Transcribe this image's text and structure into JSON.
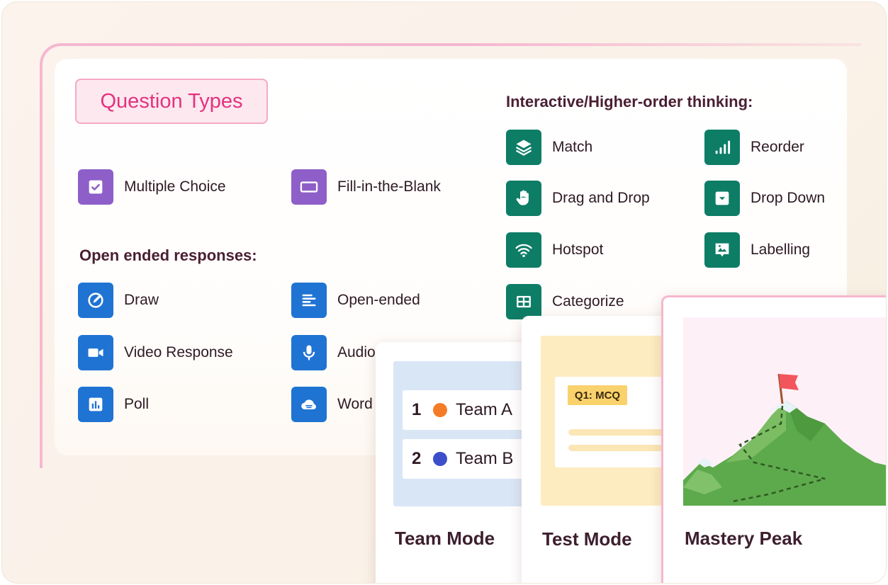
{
  "title": "Question Types",
  "basic_items": [
    {
      "label": "Multiple Choice",
      "icon": "checkbox-icon"
    },
    {
      "label": "Fill-in-the-Blank",
      "icon": "blank-box-icon"
    }
  ],
  "open_ended": {
    "heading": "Open ended responses:",
    "items": [
      {
        "label": "Draw",
        "icon": "pen-icon"
      },
      {
        "label": "Open-ended",
        "icon": "text-lines-icon"
      },
      {
        "label": "Video Response",
        "icon": "video-camera-icon"
      },
      {
        "label": "Audio",
        "icon": "microphone-icon"
      },
      {
        "label": "Poll",
        "icon": "bar-chart-icon"
      },
      {
        "label": "Word",
        "icon": "cloud-icon"
      }
    ]
  },
  "interactive": {
    "heading": "Interactive/Higher-order thinking:",
    "items": [
      {
        "label": "Match",
        "icon": "layers-icon"
      },
      {
        "label": "Reorder",
        "icon": "signal-bars-icon"
      },
      {
        "label": "Drag and Drop",
        "icon": "hand-icon"
      },
      {
        "label": "Drop Down",
        "icon": "dropdown-icon"
      },
      {
        "label": "Hotspot",
        "icon": "wifi-icon"
      },
      {
        "label": "Labelling",
        "icon": "image-label-icon"
      },
      {
        "label": "Categorize",
        "icon": "table-icon"
      }
    ]
  },
  "cards": {
    "team": {
      "title": "Team Mode",
      "rows": [
        {
          "num": "1",
          "name": "Team A",
          "color": "#f57c26"
        },
        {
          "num": "2",
          "name": "Team B",
          "color": "#3c4ec9"
        }
      ]
    },
    "test": {
      "title": "Test Mode",
      "tag": "Q1: MCQ"
    },
    "mastery": {
      "title": "Mastery Peak"
    }
  },
  "colors": {
    "accent_pink": "#e4327f",
    "purple_icon": "#8e5fc8",
    "blue_icon": "#1f73d3",
    "green_icon": "#0d7d66"
  }
}
